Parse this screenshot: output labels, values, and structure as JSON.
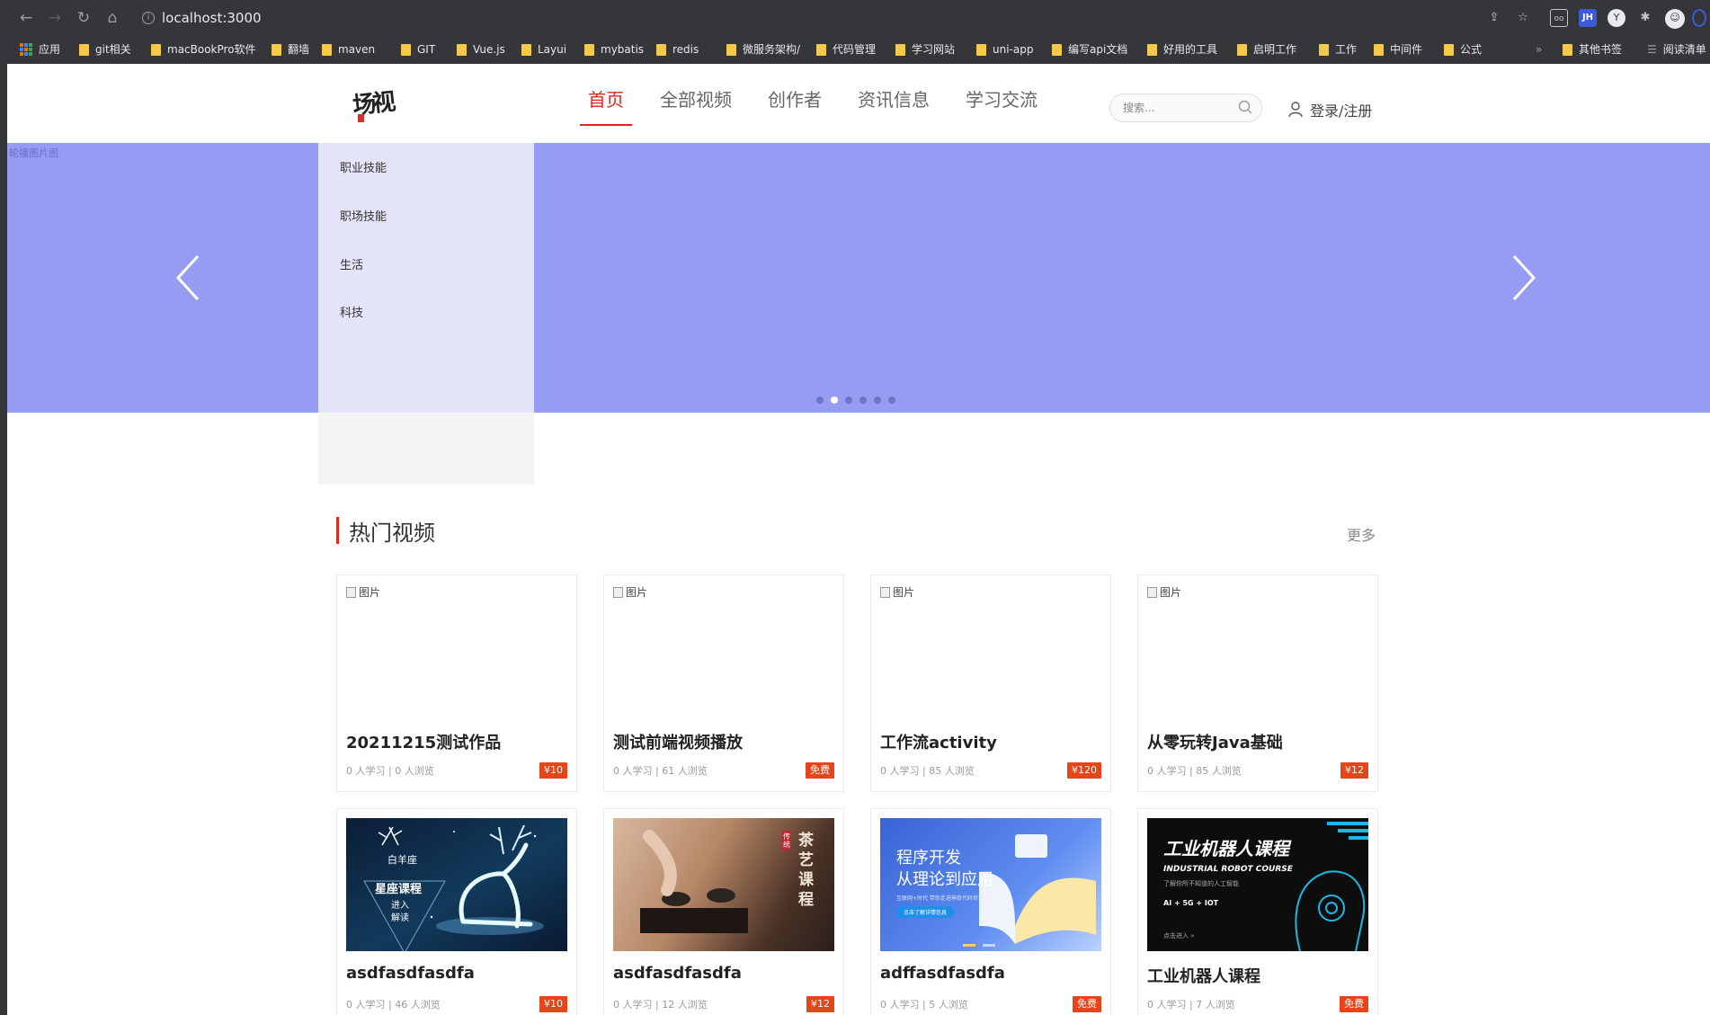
{
  "browser": {
    "url": "localhost:3000",
    "bookmarks": [
      {
        "label": "应用",
        "type": "apps"
      },
      {
        "label": "git相关",
        "type": "folder"
      },
      {
        "label": "macBookPro软件",
        "type": "folder"
      },
      {
        "label": "翻墙",
        "type": "folder"
      },
      {
        "label": "maven",
        "type": "folder"
      },
      {
        "label": "GIT",
        "type": "folder"
      },
      {
        "label": "Vue.js",
        "type": "folder"
      },
      {
        "label": "Layui",
        "type": "folder"
      },
      {
        "label": "mybatis",
        "type": "folder"
      },
      {
        "label": "redis",
        "type": "folder"
      },
      {
        "label": "微服务架构/",
        "type": "folder"
      },
      {
        "label": "代码管理",
        "type": "folder"
      },
      {
        "label": "学习网站",
        "type": "folder"
      },
      {
        "label": "uni-app",
        "type": "folder"
      },
      {
        "label": "编写api文档",
        "type": "folder"
      },
      {
        "label": "好用的工具",
        "type": "folder"
      },
      {
        "label": "启明工作",
        "type": "folder"
      },
      {
        "label": "工作",
        "type": "folder"
      },
      {
        "label": "中间件",
        "type": "folder"
      },
      {
        "label": "公式",
        "type": "folder"
      }
    ],
    "bookmarks_more": "»",
    "other_bookmarks": "其他书签",
    "reading_list": "阅读清单",
    "ext_jh": "JH"
  },
  "header": {
    "nav": [
      "首页",
      "全部视频",
      "创作者",
      "资讯信息",
      "学习交流"
    ],
    "active_nav": 0,
    "search_placeholder": "搜索...",
    "login": "登录/注册"
  },
  "banner": {
    "alt_text": "轮播图片图",
    "dot_count": 6,
    "active_dot": 1,
    "background": "#959cf2"
  },
  "categories": [
    "职业技能",
    "职场技能",
    "生活",
    "科技"
  ],
  "section": {
    "title": "热门视频",
    "more": "更多"
  },
  "broken_image_alt": "图片",
  "videos": [
    {
      "title": "20211215测试作品",
      "learners": "0",
      "views": "0",
      "price": "¥10",
      "thumb": "broken"
    },
    {
      "title": "测试前端视频播放",
      "learners": "0",
      "views": "61",
      "price": "免费",
      "thumb": "broken"
    },
    {
      "title": "工作流activity",
      "learners": "0",
      "views": "85",
      "price": "¥120",
      "thumb": "broken"
    },
    {
      "title": "从零玩转Java基础",
      "learners": "0",
      "views": "85",
      "price": "¥12",
      "thumb": "broken"
    },
    {
      "title": "asdfasdfasdfa",
      "learners": "0",
      "views": "46",
      "price": "¥10",
      "thumb": "deer"
    },
    {
      "title": "asdfasdfasdfa",
      "learners": "0",
      "views": "12",
      "price": "¥12",
      "thumb": "tea"
    },
    {
      "title": "adffasdfasdfa",
      "learners": "0",
      "views": "5",
      "price": "免费",
      "thumb": "prog"
    },
    {
      "title": "工业机器人课程",
      "learners": "0",
      "views": "7",
      "price": "免费",
      "thumb": "robot"
    }
  ],
  "meta_learn_suffix": " 人学习",
  "meta_view_suffix": " 人浏览",
  "thumbs": {
    "deer": {
      "line1": "白羊座",
      "line2": "星座课程",
      "line3": "进入",
      "line4": "解读"
    },
    "tea": {
      "title": "茶艺课程",
      "tag": "传统"
    },
    "prog": {
      "line1": "程序开发",
      "line2": "从理论到应用",
      "line3": "互联网+时代 带你走进神奇代码世界",
      "btn": "点击了解详情信息"
    },
    "robot": {
      "title": "工业机器人课程",
      "sub": "INDUSTRIAL ROBOT COURSE",
      "desc": "了解你所不知道的人工智能",
      "tags": "AI + 5G + IOT",
      "enter": "点击进入 »"
    }
  },
  "logo": {
    "text": "场视"
  }
}
